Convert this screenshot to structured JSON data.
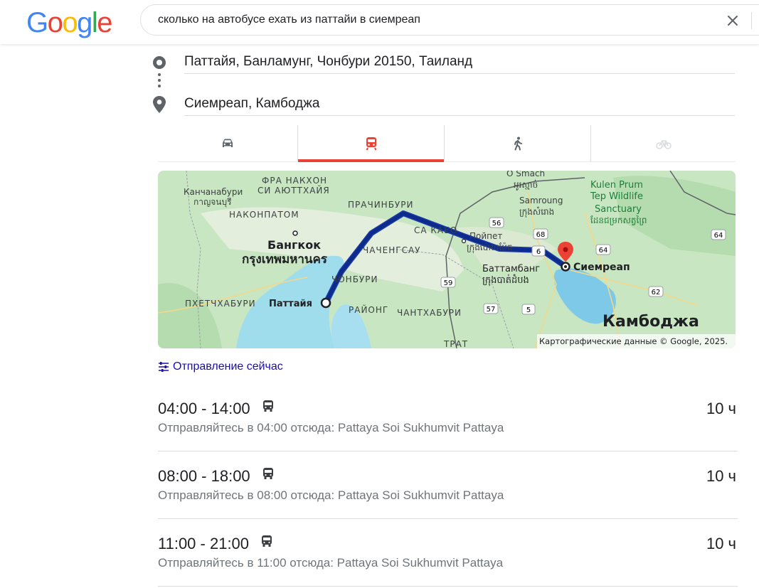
{
  "header": {
    "logo_letters": [
      "G",
      "o",
      "o",
      "g",
      "l",
      "e"
    ],
    "search_query": "сколько на автобусе ехать из паттайи в сиемреап",
    "clear_icon": "close-icon"
  },
  "route": {
    "origin": "Паттайя, Банламунг, Чонбури 20150, Таиланд",
    "destination": "Сиемреап, Камбоджа"
  },
  "tabs": [
    {
      "name": "driving",
      "icon": "car-icon",
      "active": false
    },
    {
      "name": "transit",
      "icon": "train-icon",
      "active": true
    },
    {
      "name": "walking",
      "icon": "walk-icon",
      "active": false
    },
    {
      "name": "cycling",
      "icon": "bike-icon",
      "active": false
    }
  ],
  "map": {
    "labels": {
      "kanchanaburi": "Канчанабури",
      "kanchanaburi_th": "กาญจนบุรี",
      "phra_nakhon": "ФРА НАКХОН",
      "si_ayutthaya": "СИ АЮТТХАЙЯ",
      "nakhon_pathom": "НАКОНПАТОМ",
      "bangkok": "Бангкок",
      "bangkok_th": "กรุงเทพมหานคร",
      "prachinburi": "ПРАЧИНБУРИ",
      "sa_kaeo": "СА КАЕО",
      "chachoengsao": "ЧАЧЕНГСАУ",
      "chonburi": "ЧОНБУРИ",
      "phetchaburi": "ПХЕТЧХАБУРИ",
      "pattaya": "Паттайя",
      "rayong": "РАЙОНГ",
      "chanthaburi": "ЧАНТХАБУРИ",
      "trat": "ТРАТ",
      "o_smach": "O Smach",
      "o_smach_kh": "អូរស្មាច់",
      "kulen_1": "Kulen Prum",
      "kulen_2": "Tep Wildlife",
      "kulen_3": "Sanctuary",
      "kulen_kh": "ដែនជម្រកសត្វព្រៃ",
      "samroung": "Samroung",
      "samroung_kh": "ក្រុងសំរោង",
      "poipet": "Пойпет",
      "poipet_kh": "ក្រុងប៉ោយប៉ែត",
      "battambang": "Баттамбанг",
      "battambang_kh": "ក្រុងបាត់ដំបង",
      "siem_reap": "Сиемреап",
      "cambodia": "Камбоджа",
      "attribution": "Картографические данные © Google, 2025."
    },
    "road_shields": [
      "56",
      "68",
      "6",
      "64",
      "64",
      "59",
      "57",
      "5",
      "62"
    ]
  },
  "depart_now": "Отправление сейчас",
  "trips": [
    {
      "time": "04:00 - 14:00",
      "duration": "10 ч",
      "note": "Отправляйтесь в 04:00 отсюда: Pattaya Soi Sukhumvit Pattaya"
    },
    {
      "time": "08:00 - 18:00",
      "duration": "10 ч",
      "note": "Отправляйтесь в 08:00 отсюда: Pattaya Soi Sukhumvit Pattaya"
    },
    {
      "time": "11:00 - 21:00",
      "duration": "10 ч",
      "note": "Отправляйтесь в 11:00 отсюда: Pattaya Soi Sukhumvit Pattaya"
    }
  ],
  "colors": {
    "accent_red": "#ea4335",
    "route_blue": "#0d2b8a",
    "link_blue": "#1a0dab"
  }
}
